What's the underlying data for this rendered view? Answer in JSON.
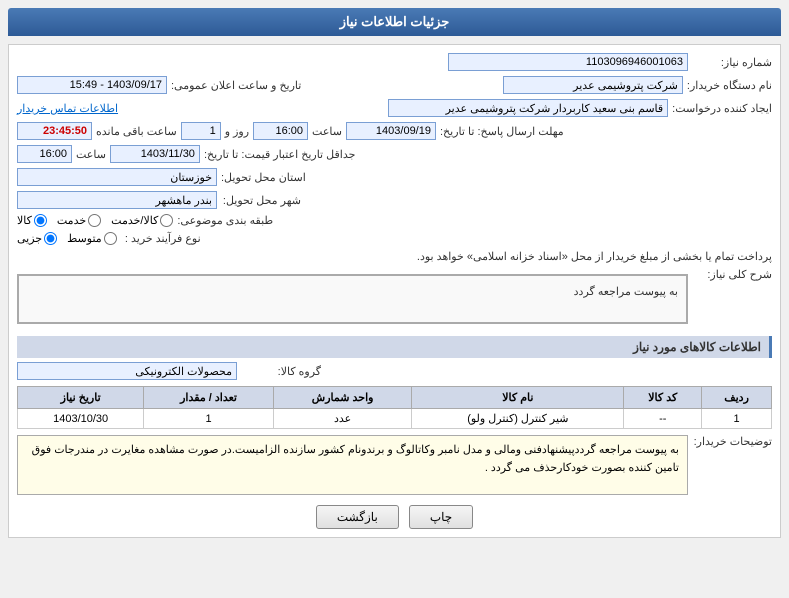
{
  "header": {
    "title": "جزئیات اطلاعات نیاز"
  },
  "form": {
    "shomara_niaz_label": "شماره نیاز:",
    "shomara_niaz_value": "1103096946001063",
    "nam_dastgah_label": "نام دستگاه خریدار:",
    "nam_dastgah_value": "شرکت پتروشیمی عدیر",
    "tarikh_saaat_label": "تاریخ و ساعت اعلان عمومی:",
    "tarikh_saat_value": "1403/09/17 - 15:49",
    "ijad_label": "ایجاد کننده درخواست:",
    "ijad_value": "قاسم بنی سعید کاربردار شرکت پتروشیمی عدیر",
    "ettelaat_link": "اطلاعات تماس خریدار",
    "mohlat_label": "مهلت ارسال پاسخ: تا تاریخ:",
    "mohlat_date": "1403/09/19",
    "mohlat_saat": "16:00",
    "mohlat_roz": "1",
    "mohlat_baqi": "23:45:50",
    "jadaval_label": "جداقل تاریخ اعتبار قیمت: تا تاریخ:",
    "jadaval_date": "1403/11/30",
    "jadaval_saat": "16:00",
    "ostan_label": "استان محل تحویل:",
    "ostan_value": "خوزستان",
    "shahr_label": "شهر محل تحویل:",
    "shahr_value": "بندر ماهشهر",
    "tabaqa_label": "طبقه بندی موضوعی:",
    "tabaqa_options": [
      "کالا",
      "خدمت",
      "کالا/خدمت"
    ],
    "tabaqa_selected": "کالا",
    "now_label": "نوع فرآیند خرید :",
    "now_options": [
      "جزیی",
      "متوسط"
    ],
    "now_selected": "متوسط",
    "note_text": "پرداخت تمام یا بخشی از مبلغ خریدار از محل «اسناد خزانه اسلامی» خواهد بود.",
    "srh_label": "شرح کلی نیاز:",
    "srh_value": "به پیوست مراجعه گردد",
    "ettelaat_kala_title": "اطلاعات کالاهای مورد نیاز",
    "group_kala_label": "گروه کالا:",
    "group_kala_value": "محصولات الکترونیکی",
    "table": {
      "headers": [
        "ردیف",
        "کد کالا",
        "نام کالا",
        "واحد شمارش",
        "تعداد / مقدار",
        "تاریخ نیاز"
      ],
      "rows": [
        {
          "radif": "1",
          "kod": "--",
          "nam": "شیر کنترل (کنترل ولو)",
          "vahed": "عدد",
          "tedad": "1",
          "tarikh": "1403/10/30"
        }
      ]
    },
    "tozi_label": "توضیحات خریدار:",
    "tozi_value": "به پیوست مراجعه گرددپیشنهادفنی ومالی و مدل نامبر وکاتالوگ و برندونام کشور سازنده الزامیست.در صورت مشاهده مغایرت در مندرجات فوق تامین کننده بصورت خودکارحذف می گردد .",
    "btn_bazgasht": "بازگشت",
    "btn_chap": "چاپ"
  }
}
